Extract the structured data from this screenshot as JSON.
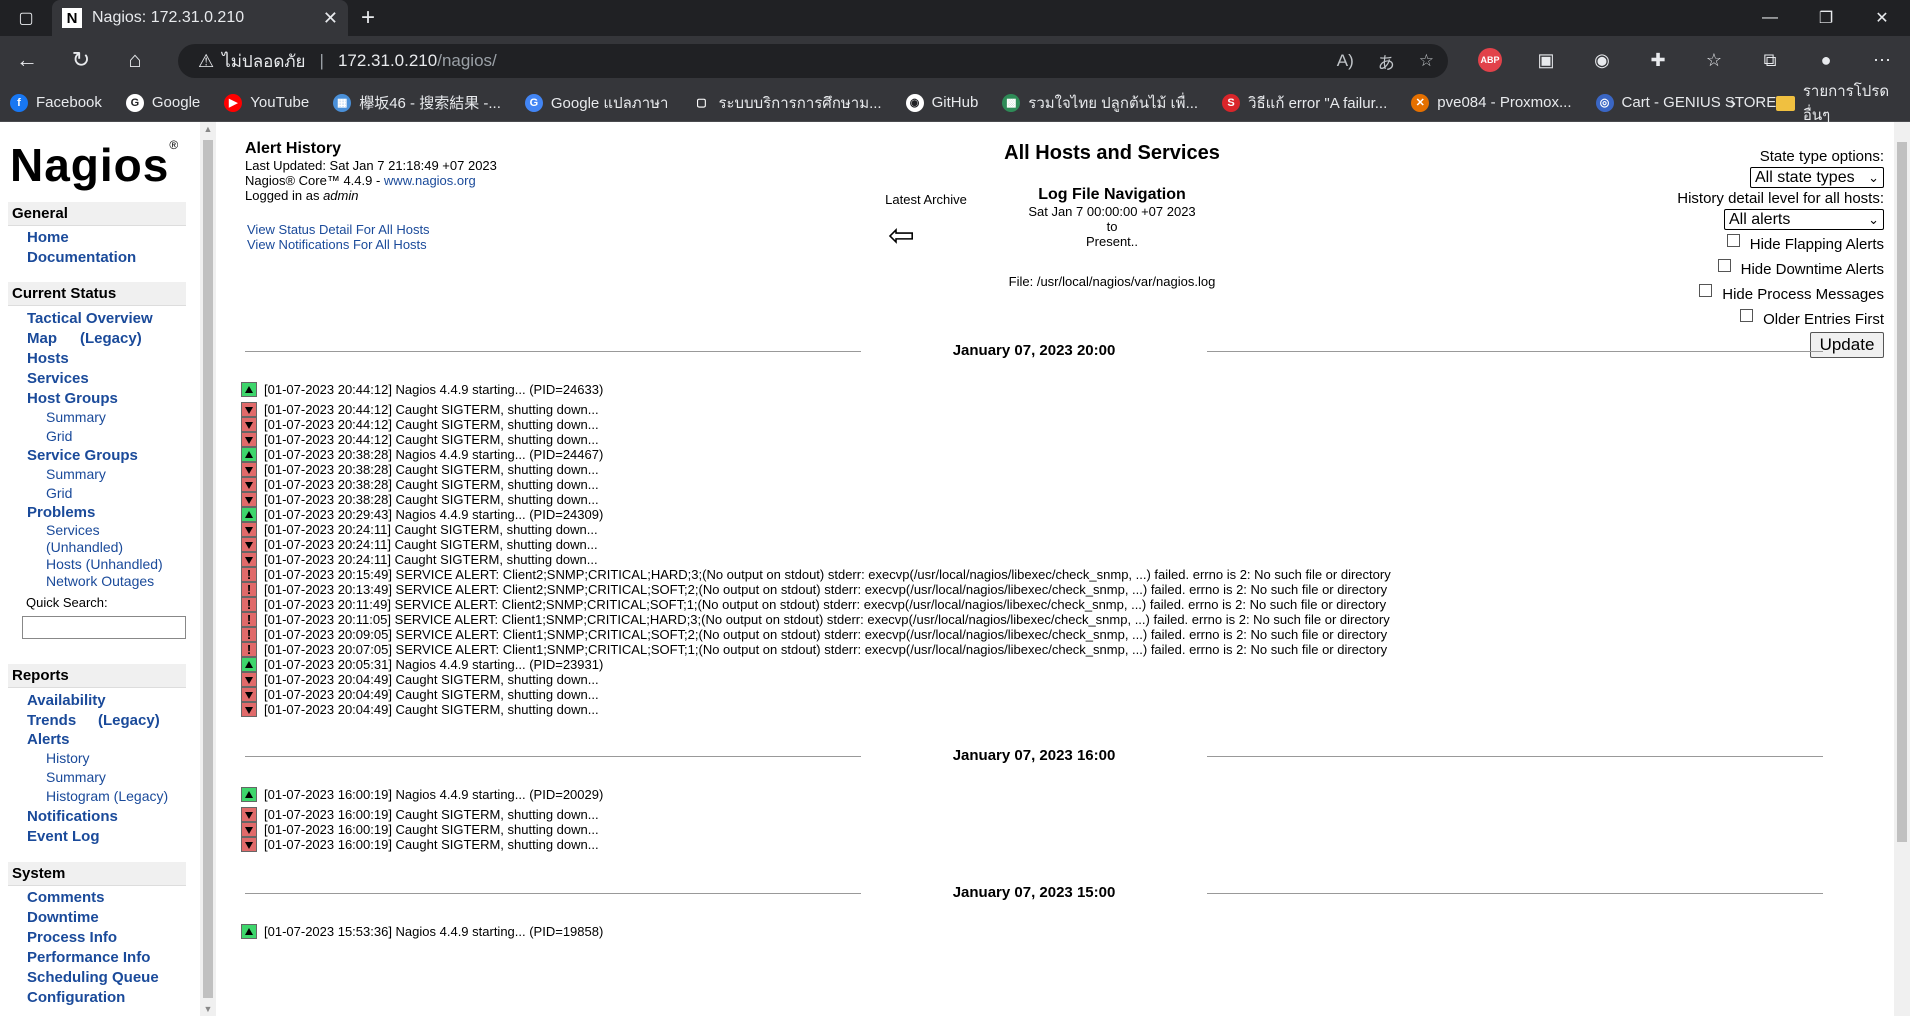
{
  "browser": {
    "tab_title": "Nagios: 172.31.0.210",
    "tab_favicon": "N",
    "address_security": "ไม่ปลอดภัย",
    "address_host": "172.31.0.210",
    "address_path": "/nagios/",
    "bookmarks": [
      {
        "label": "Facebook",
        "color": "#1877f2",
        "glyph": "f"
      },
      {
        "label": "Google",
        "color": "#ffffff",
        "glyph": "G"
      },
      {
        "label": "YouTube",
        "color": "#ff0000",
        "glyph": "▶"
      },
      {
        "label": "欅坂46 - 搜索結果 -...",
        "color": "#4a90d9",
        "glyph": "▦"
      },
      {
        "label": "Google แปลภาษา",
        "color": "#4285f4",
        "glyph": "G"
      },
      {
        "label": "ระบบบริการการศึกษาม...",
        "color": "#35363a",
        "glyph": "▢"
      },
      {
        "label": "GitHub",
        "color": "#ffffff",
        "glyph": "◉"
      },
      {
        "label": "รวมใจไทย ปลูกต้นไม้ เพื่...",
        "color": "#2e8b57",
        "glyph": "▩"
      },
      {
        "label": "วิธีแก้ error \"A failur...",
        "color": "#d9252a",
        "glyph": "S"
      },
      {
        "label": "pve084 - Proxmox...",
        "color": "#e57000",
        "glyph": "✕"
      },
      {
        "label": "Cart - GENIUS STORE",
        "color": "#3a66c4",
        "glyph": "◎"
      }
    ],
    "bookmark_folder": "รายการโปรดอื่นๆ",
    "abp_badge": "ABP"
  },
  "nav": {
    "sections": {
      "general": "General",
      "current_status": "Current Status",
      "reports": "Reports",
      "system": "System"
    },
    "general": [
      "Home",
      "Documentation"
    ],
    "current_status": {
      "tactical": "Tactical Overview",
      "map": "Map",
      "map_legacy": "(Legacy)",
      "hosts": "Hosts",
      "services": "Services",
      "host_groups": "Host Groups",
      "hg_summary": "Summary",
      "hg_grid": "Grid",
      "service_groups": "Service Groups",
      "sg_summary": "Summary",
      "sg_grid": "Grid",
      "problems": "Problems",
      "p_services": "Services",
      "p_services_unh": "(Unhandled)",
      "p_hosts": "Hosts (Unhandled)",
      "p_outages": "Network Outages",
      "quick_search": "Quick Search:"
    },
    "reports": {
      "availability": "Availability",
      "trends": "Trends",
      "trends_legacy": "(Legacy)",
      "alerts": "Alerts",
      "history": "History",
      "summary": "Summary",
      "histogram": "Histogram (Legacy)",
      "notifications": "Notifications",
      "event_log": "Event Log"
    },
    "system": [
      "Comments",
      "Downtime",
      "Process Info",
      "Performance Info",
      "Scheduling Queue",
      "Configuration"
    ]
  },
  "info": {
    "title": "Alert History",
    "updated": "Last Updated: Sat Jan 7 21:18:49 +07 2023",
    "core_prefix": "Nagios® Core™ 4.4.9 - ",
    "core_link": "www.nagios.org",
    "logged_prefix": "Logged in as ",
    "logged_user": "admin",
    "link1": "View Status Detail For All Hosts",
    "link2": "View Notifications For All Hosts"
  },
  "center": {
    "title": "All Hosts and Services",
    "latest_archive": "Latest Archive",
    "lognav_title": "Log File Navigation",
    "lognav_from": "Sat Jan 7 00:00:00 +07 2023",
    "lognav_to": "to",
    "lognav_present": "Present..",
    "file": "File: /usr/local/nagios/var/nagios.log"
  },
  "options": {
    "state_type_label": "State type options:",
    "state_type_value": "All state types",
    "detail_label": "History detail level for all hosts:",
    "detail_value": "All alerts",
    "hide_flapping": "Hide Flapping Alerts",
    "hide_downtime": "Hide Downtime Alerts",
    "hide_process": "Hide Process Messages",
    "older_first": "Older Entries First",
    "update": "Update"
  },
  "hours": [
    {
      "heading": "January 07, 2023 20:00",
      "entries": [
        {
          "icon": "up",
          "text": "[01-07-2023 20:44:12] Nagios 4.4.9 starting... (PID=24633)"
        },
        {
          "icon": "down",
          "text": "[01-07-2023 20:44:12] Caught SIGTERM, shutting down..."
        },
        {
          "icon": "down",
          "text": "[01-07-2023 20:44:12] Caught SIGTERM, shutting down..."
        },
        {
          "icon": "down",
          "text": "[01-07-2023 20:44:12] Caught SIGTERM, shutting down..."
        },
        {
          "icon": "up",
          "text": "[01-07-2023 20:38:28] Nagios 4.4.9 starting... (PID=24467)"
        },
        {
          "icon": "down",
          "text": "[01-07-2023 20:38:28] Caught SIGTERM, shutting down..."
        },
        {
          "icon": "down",
          "text": "[01-07-2023 20:38:28] Caught SIGTERM, shutting down..."
        },
        {
          "icon": "down",
          "text": "[01-07-2023 20:38:28] Caught SIGTERM, shutting down..."
        },
        {
          "icon": "up",
          "text": "[01-07-2023 20:29:43] Nagios 4.4.9 starting... (PID=24309)"
        },
        {
          "icon": "down",
          "text": "[01-07-2023 20:24:11] Caught SIGTERM, shutting down..."
        },
        {
          "icon": "down",
          "text": "[01-07-2023 20:24:11] Caught SIGTERM, shutting down..."
        },
        {
          "icon": "down",
          "text": "[01-07-2023 20:24:11] Caught SIGTERM, shutting down..."
        },
        {
          "icon": "warn",
          "text": "[01-07-2023 20:15:49] SERVICE ALERT: Client2;SNMP;CRITICAL;HARD;3;(No output on stdout) stderr: execvp(/usr/local/nagios/libexec/check_snmp, ...) failed. errno is 2: No such file or directory"
        },
        {
          "icon": "warn",
          "text": "[01-07-2023 20:13:49] SERVICE ALERT: Client2;SNMP;CRITICAL;SOFT;2;(No output on stdout) stderr: execvp(/usr/local/nagios/libexec/check_snmp, ...) failed. errno is 2: No such file or directory"
        },
        {
          "icon": "warn",
          "text": "[01-07-2023 20:11:49] SERVICE ALERT: Client2;SNMP;CRITICAL;SOFT;1;(No output on stdout) stderr: execvp(/usr/local/nagios/libexec/check_snmp, ...) failed. errno is 2: No such file or directory"
        },
        {
          "icon": "warn",
          "text": "[01-07-2023 20:11:05] SERVICE ALERT: Client1;SNMP;CRITICAL;HARD;3;(No output on stdout) stderr: execvp(/usr/local/nagios/libexec/check_snmp, ...) failed. errno is 2: No such file or directory"
        },
        {
          "icon": "warn",
          "text": "[01-07-2023 20:09:05] SERVICE ALERT: Client1;SNMP;CRITICAL;SOFT;2;(No output on stdout) stderr: execvp(/usr/local/nagios/libexec/check_snmp, ...) failed. errno is 2: No such file or directory"
        },
        {
          "icon": "warn",
          "text": "[01-07-2023 20:07:05] SERVICE ALERT: Client1;SNMP;CRITICAL;SOFT;1;(No output on stdout) stderr: execvp(/usr/local/nagios/libexec/check_snmp, ...) failed. errno is 2: No such file or directory"
        },
        {
          "icon": "up",
          "text": "[01-07-2023 20:05:31] Nagios 4.4.9 starting... (PID=23931)"
        },
        {
          "icon": "down",
          "text": "[01-07-2023 20:04:49] Caught SIGTERM, shutting down..."
        },
        {
          "icon": "down",
          "text": "[01-07-2023 20:04:49] Caught SIGTERM, shutting down..."
        },
        {
          "icon": "down",
          "text": "[01-07-2023 20:04:49] Caught SIGTERM, shutting down..."
        }
      ]
    },
    {
      "heading": "January 07, 2023 16:00",
      "entries": [
        {
          "icon": "up",
          "text": "[01-07-2023 16:00:19] Nagios 4.4.9 starting... (PID=20029)"
        },
        {
          "icon": "down",
          "text": "[01-07-2023 16:00:19] Caught SIGTERM, shutting down..."
        },
        {
          "icon": "down",
          "text": "[01-07-2023 16:00:19] Caught SIGTERM, shutting down..."
        },
        {
          "icon": "down",
          "text": "[01-07-2023 16:00:19] Caught SIGTERM, shutting down..."
        }
      ]
    },
    {
      "heading": "January 07, 2023 15:00",
      "entries": [
        {
          "icon": "up",
          "text": "[01-07-2023 15:53:36] Nagios 4.4.9 starting... (PID=19858)"
        }
      ]
    }
  ]
}
